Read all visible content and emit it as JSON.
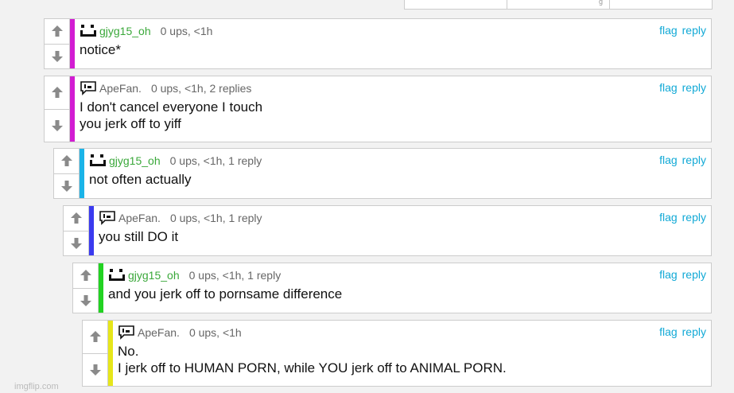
{
  "colors": {
    "accent": "#11a9d6",
    "username_green": "#3aa83a",
    "text_gray": "#666666"
  },
  "comments": [
    {
      "user": "gjyg15_oh",
      "meta": "0 ups, <1h",
      "body": [
        "notice*"
      ],
      "bar_color": "#d21cd2",
      "avatar": "face-icon",
      "flag": "flag",
      "reply": "reply"
    },
    {
      "user": "ApeFan.",
      "meta": "0 ups, <1h, 2 replies",
      "body": [
        "I don't cancel everyone I touch",
        "you jerk off to yiff"
      ],
      "bar_color": "#d21cd2",
      "avatar": "speech-icon",
      "flag": "flag",
      "reply": "reply"
    },
    {
      "user": "gjyg15_oh",
      "meta": "0 ups, <1h, 1 reply",
      "body": [
        "not often actually"
      ],
      "bar_color": "#1ab4e8",
      "avatar": "face-icon",
      "flag": "flag",
      "reply": "reply"
    },
    {
      "user": "ApeFan.",
      "meta": "0 ups, <1h, 1 reply",
      "body": [
        "you still DO it"
      ],
      "bar_color": "#3a3aef",
      "avatar": "speech-icon",
      "flag": "flag",
      "reply": "reply"
    },
    {
      "user": "gjyg15_oh",
      "meta": "0 ups, <1h, 1 reply",
      "body": [
        "and you jerk off to pornsame difference"
      ],
      "bar_color": "#22d322",
      "avatar": "face-icon",
      "flag": "flag",
      "reply": "reply"
    },
    {
      "user": "ApeFan.",
      "meta": "0 ups, <1h",
      "body": [
        "No.",
        "I jerk off to HUMAN PORN, while YOU jerk off to ANIMAL PORN."
      ],
      "bar_color": "#e6e61a",
      "avatar": "speech-icon",
      "flag": "flag",
      "reply": "reply"
    }
  ],
  "watermark": "imgflip.com"
}
